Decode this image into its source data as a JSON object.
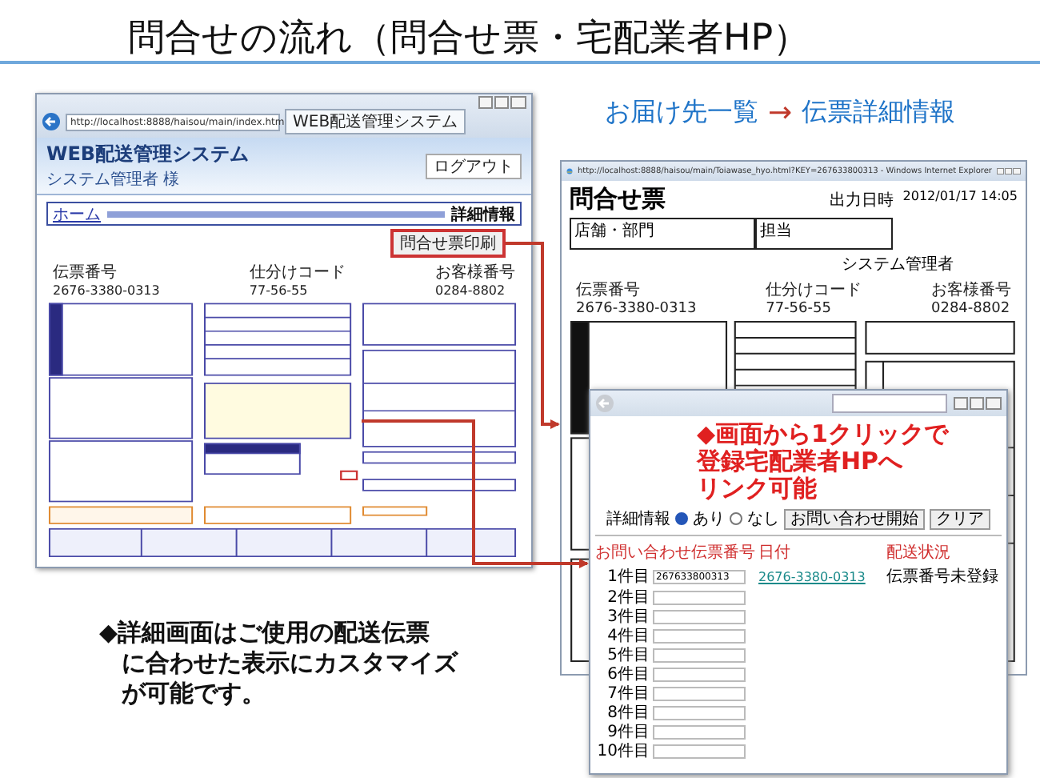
{
  "slide_title": "問合せの流れ（問合せ票・宅配業者HP）",
  "detail_window": {
    "address": "http://localhost:8888/haisou/main/index.htm",
    "tab": "WEB配送管理システム",
    "app_title": "WEB配送管理システム",
    "user": "システム管理者 様",
    "logout_button": "ログアウト",
    "breadcrumb_home": "ホーム",
    "breadcrumb_current": "詳細情報",
    "print_button": "問合せ票印刷",
    "fields": [
      {
        "label": "伝票番号",
        "value": "2676-3380-0313"
      },
      {
        "label": "仕分けコード",
        "value": "77-56-55"
      },
      {
        "label": "お客様番号",
        "value": "0284-8802"
      }
    ]
  },
  "flow_caption": {
    "from": "お届け先一覧",
    "arrow": "→",
    "to": "伝票詳細情報"
  },
  "slip_window": {
    "address": "http://localhost:8888/haisou/main/Toiawase_hyo.html?KEY=267633800313 - Windows Internet Explorer",
    "heading": "問合せ票",
    "output_label": "出力日時",
    "output_time": "2012/01/17 14:05",
    "office_label": "店舗・部門",
    "staff_label": "担当",
    "manager": "システム管理者",
    "fields": [
      {
        "label": "伝票番号",
        "value": "2676-3380-0313"
      },
      {
        "label": "仕分けコード",
        "value": "77-56-55"
      },
      {
        "label": "お客様番号",
        "value": "0284-8802"
      }
    ]
  },
  "tracking_popup": {
    "note_lines": [
      "◆画面から1クリックで",
      "登録宅配業者HPへ",
      "リンク可能"
    ],
    "detail_label": "詳細情報",
    "options": [
      {
        "label": "あり",
        "selected": true
      },
      {
        "label": "なし",
        "selected": false
      }
    ],
    "buttons": [
      "お問い合わせ開始",
      "クリア"
    ],
    "columns": [
      "お問い合わせ伝票番号",
      "日付",
      "配送状況"
    ],
    "rows": [
      {
        "label": "1件目",
        "value": "267633800313",
        "link": "2676-3380-0313",
        "status": "伝票番号未登録"
      },
      {
        "label": "2件目"
      },
      {
        "label": "3件目"
      },
      {
        "label": "4件目"
      },
      {
        "label": "5件目"
      },
      {
        "label": "6件目"
      },
      {
        "label": "7件目"
      },
      {
        "label": "8件目"
      },
      {
        "label": "9件目"
      },
      {
        "label": "10件目"
      }
    ]
  },
  "caption_lines": [
    "◆詳細画面はご使用の配送伝票",
    "に合わせた表示にカスタマイズ",
    "が可能です。"
  ]
}
